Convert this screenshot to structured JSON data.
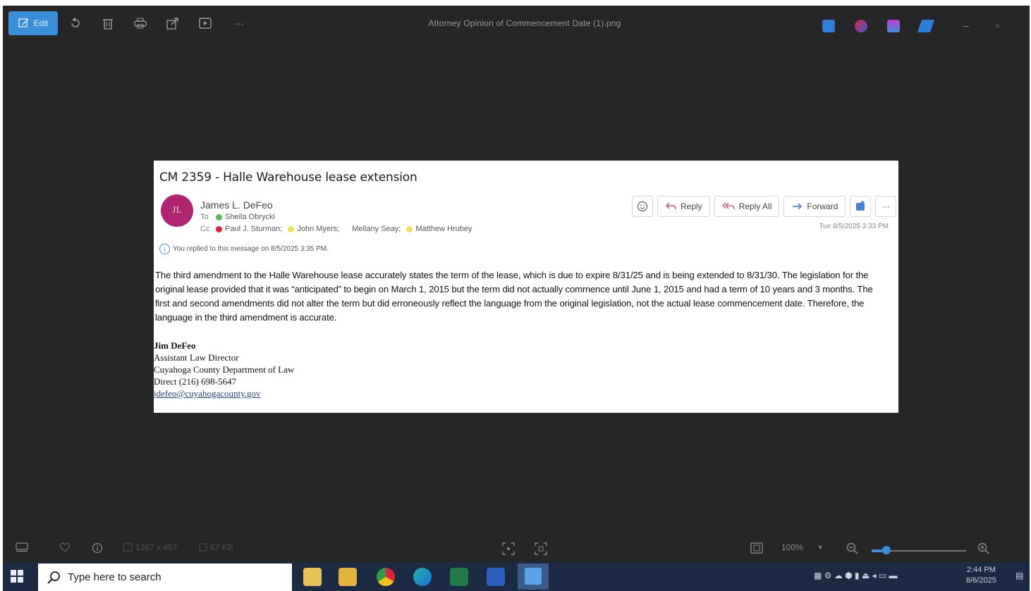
{
  "toolbar": {
    "edit_label": "Edit",
    "window_title": "Attorney Opinion of Commencement Date (1).png",
    "more_label": "···",
    "minimize_label": "–",
    "restore_label": "▫"
  },
  "email": {
    "subject": "CM 2359 - Halle Warehouse lease extension",
    "avatar_initials": "JL",
    "sender": "James L. DeFeo",
    "to_label": "To",
    "to": [
      {
        "name": "Sheila Obrycki",
        "status_color": "#5cb85c"
      }
    ],
    "cc_label": "Cc",
    "cc": [
      {
        "name": "Paul J. Sturman;",
        "status_color": "#e0243a"
      },
      {
        "name": "John Myers;",
        "status_color": "#f3e15a"
      },
      {
        "name": "Mellany Seay;",
        "status_color": ""
      },
      {
        "name": "Matthew Hrubey",
        "status_color": "#f3e15a"
      }
    ],
    "replied_note": "You replied to this message on 8/5/2025 3:35 PM.",
    "actions": {
      "reply": "Reply",
      "reply_all": "Reply All",
      "forward": "Forward",
      "more": "···"
    },
    "timestamp": "Tue 8/5/2025 3:33 PM",
    "body": "The third amendment to the Halle Warehouse lease accurately states the term of the lease, which is due to expire 8/31/25 and is being extended to 8/31/30. The legislation for the original lease provided that it was “anticipated” to begin on March 1, 2015 but the term did not actually commence until June 1, 2015 and had a term of 10 years and 3 months. The first and second amendments did not alter the term but did erroneously reflect the language from the original legislation, not the actual lease commencement date. Therefore, the language in the third amendment is accurate.",
    "signature": {
      "name": "Jim DeFeo",
      "title": "Assistant Law Director",
      "org": "Cuyahoga County Department of Law",
      "phone": "Direct (216) 698-5647",
      "email": "jdefeo@cuyahogacounty.gov"
    }
  },
  "statusbar": {
    "dimensions": "1367 x 457",
    "filesize": "67 KB",
    "zoom": "100%"
  },
  "taskbar": {
    "search_placeholder": "Type here to search",
    "time": "2:44 PM",
    "date": "8/6/2025"
  },
  "colors": {
    "accent": "#3b8fd9",
    "viewer_bg": "#262626",
    "avatar": "#b1246f",
    "taskbar": "#1c2a44"
  }
}
